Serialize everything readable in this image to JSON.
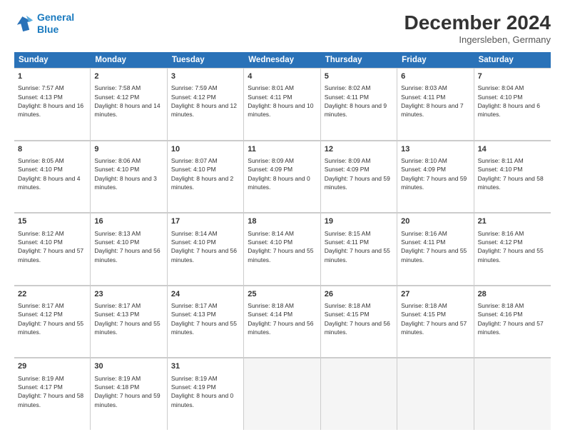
{
  "logo": {
    "line1": "General",
    "line2": "Blue"
  },
  "title": "December 2024",
  "subtitle": "Ingersleben, Germany",
  "header_days": [
    "Sunday",
    "Monday",
    "Tuesday",
    "Wednesday",
    "Thursday",
    "Friday",
    "Saturday"
  ],
  "weeks": [
    [
      {
        "day": "1",
        "sunrise": "Sunrise: 7:57 AM",
        "sunset": "Sunset: 4:13 PM",
        "daylight": "Daylight: 8 hours and 16 minutes."
      },
      {
        "day": "2",
        "sunrise": "Sunrise: 7:58 AM",
        "sunset": "Sunset: 4:12 PM",
        "daylight": "Daylight: 8 hours and 14 minutes."
      },
      {
        "day": "3",
        "sunrise": "Sunrise: 7:59 AM",
        "sunset": "Sunset: 4:12 PM",
        "daylight": "Daylight: 8 hours and 12 minutes."
      },
      {
        "day": "4",
        "sunrise": "Sunrise: 8:01 AM",
        "sunset": "Sunset: 4:11 PM",
        "daylight": "Daylight: 8 hours and 10 minutes."
      },
      {
        "day": "5",
        "sunrise": "Sunrise: 8:02 AM",
        "sunset": "Sunset: 4:11 PM",
        "daylight": "Daylight: 8 hours and 9 minutes."
      },
      {
        "day": "6",
        "sunrise": "Sunrise: 8:03 AM",
        "sunset": "Sunset: 4:11 PM",
        "daylight": "Daylight: 8 hours and 7 minutes."
      },
      {
        "day": "7",
        "sunrise": "Sunrise: 8:04 AM",
        "sunset": "Sunset: 4:10 PM",
        "daylight": "Daylight: 8 hours and 6 minutes."
      }
    ],
    [
      {
        "day": "8",
        "sunrise": "Sunrise: 8:05 AM",
        "sunset": "Sunset: 4:10 PM",
        "daylight": "Daylight: 8 hours and 4 minutes."
      },
      {
        "day": "9",
        "sunrise": "Sunrise: 8:06 AM",
        "sunset": "Sunset: 4:10 PM",
        "daylight": "Daylight: 8 hours and 3 minutes."
      },
      {
        "day": "10",
        "sunrise": "Sunrise: 8:07 AM",
        "sunset": "Sunset: 4:10 PM",
        "daylight": "Daylight: 8 hours and 2 minutes."
      },
      {
        "day": "11",
        "sunrise": "Sunrise: 8:09 AM",
        "sunset": "Sunset: 4:09 PM",
        "daylight": "Daylight: 8 hours and 0 minutes."
      },
      {
        "day": "12",
        "sunrise": "Sunrise: 8:09 AM",
        "sunset": "Sunset: 4:09 PM",
        "daylight": "Daylight: 7 hours and 59 minutes."
      },
      {
        "day": "13",
        "sunrise": "Sunrise: 8:10 AM",
        "sunset": "Sunset: 4:09 PM",
        "daylight": "Daylight: 7 hours and 59 minutes."
      },
      {
        "day": "14",
        "sunrise": "Sunrise: 8:11 AM",
        "sunset": "Sunset: 4:10 PM",
        "daylight": "Daylight: 7 hours and 58 minutes."
      }
    ],
    [
      {
        "day": "15",
        "sunrise": "Sunrise: 8:12 AM",
        "sunset": "Sunset: 4:10 PM",
        "daylight": "Daylight: 7 hours and 57 minutes."
      },
      {
        "day": "16",
        "sunrise": "Sunrise: 8:13 AM",
        "sunset": "Sunset: 4:10 PM",
        "daylight": "Daylight: 7 hours and 56 minutes."
      },
      {
        "day": "17",
        "sunrise": "Sunrise: 8:14 AM",
        "sunset": "Sunset: 4:10 PM",
        "daylight": "Daylight: 7 hours and 56 minutes."
      },
      {
        "day": "18",
        "sunrise": "Sunrise: 8:14 AM",
        "sunset": "Sunset: 4:10 PM",
        "daylight": "Daylight: 7 hours and 55 minutes."
      },
      {
        "day": "19",
        "sunrise": "Sunrise: 8:15 AM",
        "sunset": "Sunset: 4:11 PM",
        "daylight": "Daylight: 7 hours and 55 minutes."
      },
      {
        "day": "20",
        "sunrise": "Sunrise: 8:16 AM",
        "sunset": "Sunset: 4:11 PM",
        "daylight": "Daylight: 7 hours and 55 minutes."
      },
      {
        "day": "21",
        "sunrise": "Sunrise: 8:16 AM",
        "sunset": "Sunset: 4:12 PM",
        "daylight": "Daylight: 7 hours and 55 minutes."
      }
    ],
    [
      {
        "day": "22",
        "sunrise": "Sunrise: 8:17 AM",
        "sunset": "Sunset: 4:12 PM",
        "daylight": "Daylight: 7 hours and 55 minutes."
      },
      {
        "day": "23",
        "sunrise": "Sunrise: 8:17 AM",
        "sunset": "Sunset: 4:13 PM",
        "daylight": "Daylight: 7 hours and 55 minutes."
      },
      {
        "day": "24",
        "sunrise": "Sunrise: 8:17 AM",
        "sunset": "Sunset: 4:13 PM",
        "daylight": "Daylight: 7 hours and 55 minutes."
      },
      {
        "day": "25",
        "sunrise": "Sunrise: 8:18 AM",
        "sunset": "Sunset: 4:14 PM",
        "daylight": "Daylight: 7 hours and 56 minutes."
      },
      {
        "day": "26",
        "sunrise": "Sunrise: 8:18 AM",
        "sunset": "Sunset: 4:15 PM",
        "daylight": "Daylight: 7 hours and 56 minutes."
      },
      {
        "day": "27",
        "sunrise": "Sunrise: 8:18 AM",
        "sunset": "Sunset: 4:15 PM",
        "daylight": "Daylight: 7 hours and 57 minutes."
      },
      {
        "day": "28",
        "sunrise": "Sunrise: 8:18 AM",
        "sunset": "Sunset: 4:16 PM",
        "daylight": "Daylight: 7 hours and 57 minutes."
      }
    ],
    [
      {
        "day": "29",
        "sunrise": "Sunrise: 8:19 AM",
        "sunset": "Sunset: 4:17 PM",
        "daylight": "Daylight: 7 hours and 58 minutes."
      },
      {
        "day": "30",
        "sunrise": "Sunrise: 8:19 AM",
        "sunset": "Sunset: 4:18 PM",
        "daylight": "Daylight: 7 hours and 59 minutes."
      },
      {
        "day": "31",
        "sunrise": "Sunrise: 8:19 AM",
        "sunset": "Sunset: 4:19 PM",
        "daylight": "Daylight: 8 hours and 0 minutes."
      },
      null,
      null,
      null,
      null
    ]
  ]
}
